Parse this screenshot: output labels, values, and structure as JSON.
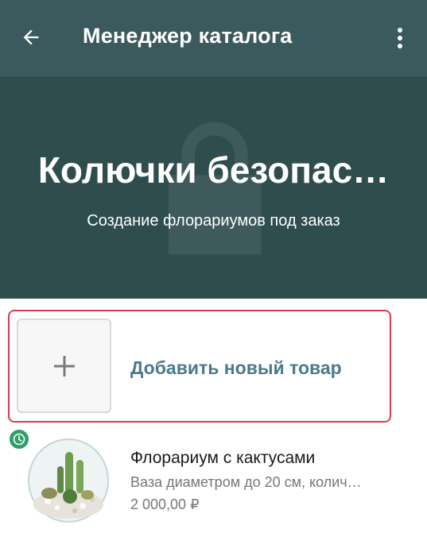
{
  "header": {
    "title": "Менеджер каталога",
    "back_icon": "arrow-left-icon",
    "menu_icon": "more-vertical-icon"
  },
  "hero": {
    "title": "Колючки безопас…",
    "subtitle": "Создание флорариумов под заказ"
  },
  "add_item": {
    "label": "Добавить новый товар",
    "icon": "plus-icon"
  },
  "products": [
    {
      "name": "Флорариум с кактусами",
      "description": "Ваза диаметром до 20 см, колич…",
      "price": "2 000,00 ₽",
      "status_icon": "clock-icon"
    }
  ],
  "colors": {
    "header_bg": "#3a5a5e",
    "hero_bg": "#2f4d4d",
    "highlight_border": "#d93a4a",
    "link_text": "#4a7a8c",
    "badge_green": "#2e9e6a"
  }
}
